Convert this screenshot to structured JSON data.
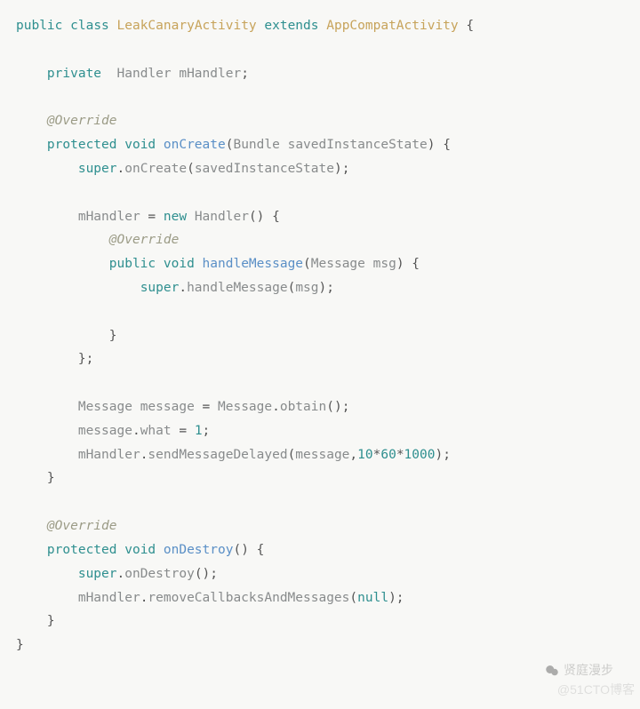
{
  "code": {
    "t": {
      "public": "public",
      "class": "class",
      "extends": "extends",
      "private": "private",
      "protected": "protected",
      "void": "void",
      "new": "new",
      "super": "super",
      "null": "null",
      "override": "@Override",
      "LeakCanaryActivity": "LeakCanaryActivity",
      "AppCompatActivity": "AppCompatActivity",
      "Handler": "Handler",
      "mHandler": "mHandler",
      "onCreate": "onCreate",
      "Bundle": "Bundle",
      "savedInstanceState": "savedInstanceState",
      "handleMessage": "handleMessage",
      "Message": "Message",
      "msg": "msg",
      "message": "message",
      "obtain": "obtain",
      "what": "what",
      "one": "1",
      "sendMessageDelayed": "sendMessageDelayed",
      "n10": "10",
      "n60": "60",
      "n1000": "1000",
      "onDestroy": "onDestroy",
      "removeCallbacksAndMessages": "removeCallbacksAndMessages"
    }
  },
  "watermark": {
    "line1": "贤庭漫步",
    "line2": "@51CTO博客"
  }
}
